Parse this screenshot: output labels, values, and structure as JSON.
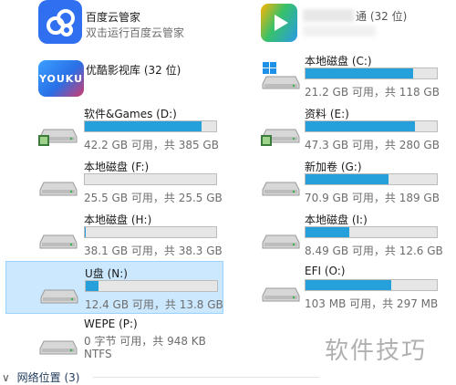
{
  "apps": {
    "baidu": {
      "name": "百度云管家",
      "subtitle": "双击运行百度云管家"
    },
    "youku": {
      "name": "优酷影视库 (32 位)",
      "logo_text": "YOUKU"
    },
    "qq_video": {
      "name_visible": "通 (32 位)"
    }
  },
  "drives": [
    {
      "name": "本地磁盘 (C:)",
      "info": "21.2 GB 可用，共 118 GB",
      "used_fraction": 0.82,
      "icon": "windows-drive-icon"
    },
    {
      "name": "软件&Games (D:)",
      "info": "42.2 GB 可用，共 385 GB",
      "used_fraction": 0.89,
      "icon": "shared-drive-icon"
    },
    {
      "name": "资料 (E:)",
      "info": "47.3 GB 可用，共 280 GB",
      "used_fraction": 0.83,
      "icon": "shared-drive-icon"
    },
    {
      "name": "本地磁盘 (F:)",
      "info": "25.5 GB 可用，共 25.5 GB",
      "used_fraction": 0.0,
      "icon": "drive-icon"
    },
    {
      "name": "新加卷 (G:)",
      "info": "70.9 GB 可用，共 189 GB",
      "used_fraction": 0.63,
      "icon": "drive-icon"
    },
    {
      "name": "本地磁盘 (H:)",
      "info": "38.1 GB 可用，共 38.3 GB",
      "used_fraction": 0.005,
      "icon": "drive-icon"
    },
    {
      "name": "本地磁盘 (I:)",
      "info": "8.49 GB 可用，共 12.6 GB",
      "used_fraction": 0.33,
      "icon": "drive-icon"
    },
    {
      "name": "U盘 (N:)",
      "info": "12.4 GB 可用，共 13.8 GB",
      "used_fraction": 0.1,
      "icon": "usb-drive-icon",
      "selected": true
    },
    {
      "name": "EFI (O:)",
      "info": "103 MB 可用，共 297 MB",
      "used_fraction": 0.65,
      "icon": "drive-icon"
    },
    {
      "name": "WEPE (P:)",
      "info": "0 字节 可用，共 948 KB",
      "filesystem": "NTFS",
      "icon": "drive-icon"
    }
  ],
  "network_section": {
    "label": "网络位置 (3)"
  },
  "watermark": "软件技巧",
  "colors": {
    "bar_fill": "#26a0da",
    "selection_bg": "#cce8ff",
    "selection_border": "#99d1ff"
  }
}
